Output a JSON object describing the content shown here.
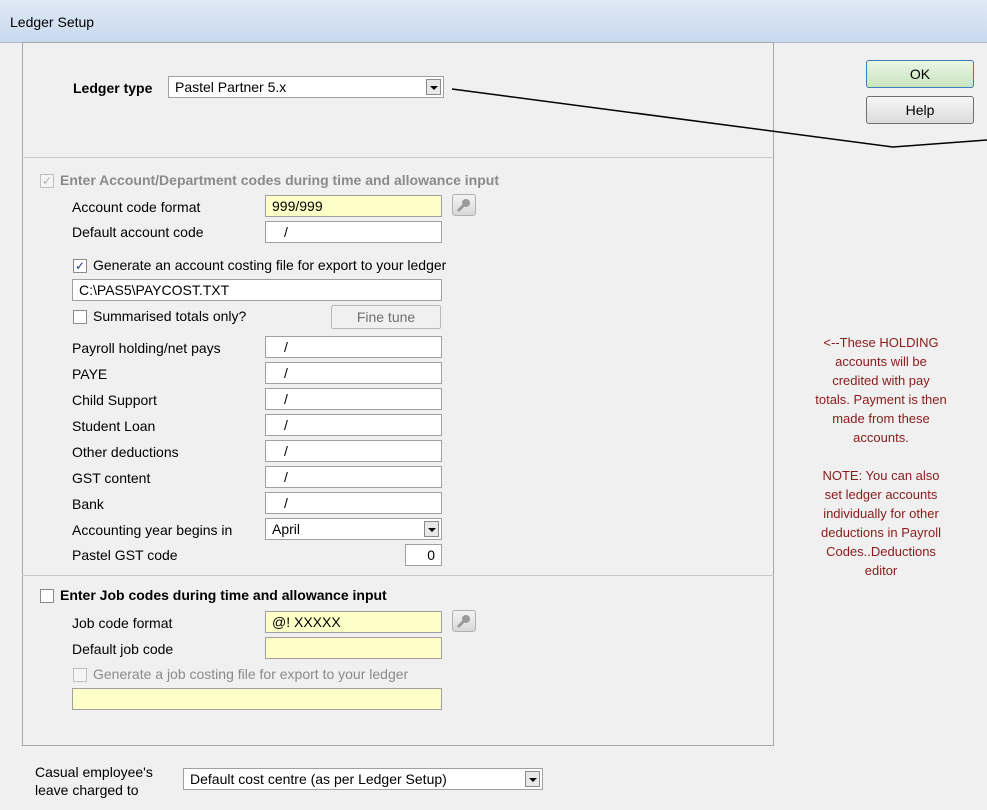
{
  "window": {
    "title": "Ledger Setup"
  },
  "buttons": {
    "ok": "OK",
    "help": "Help",
    "fine_tune": "Fine tune"
  },
  "ledger": {
    "label": "Ledger type",
    "value": "Pastel Partner 5.x"
  },
  "account_codes": {
    "enable_label": "Enter Account/Department codes during time and allowance input",
    "enable_checked": true,
    "format_label": "Account code format",
    "format_value": "999/999",
    "default_label": "Default account code",
    "default_value": "/",
    "generate_label": "Generate an account costing file for export to your ledger",
    "generate_checked": true,
    "file_path": "C:\\PAS5\\PAYCOST.TXT",
    "summarised_label": "Summarised totals only?",
    "summarised_checked": false
  },
  "holding_accounts": [
    {
      "label": "Payroll holding/net pays",
      "value": "/"
    },
    {
      "label": "PAYE",
      "value": "/"
    },
    {
      "label": "Child Support",
      "value": "/"
    },
    {
      "label": "Student Loan",
      "value": "/"
    },
    {
      "label": "Other deductions",
      "value": "/"
    },
    {
      "label": "GST content",
      "value": "/"
    },
    {
      "label": "Bank",
      "value": "/"
    }
  ],
  "accounting_year": {
    "label": "Accounting year begins in",
    "value": "April"
  },
  "gst_code": {
    "label": "Pastel GST code",
    "value": "0"
  },
  "job_codes": {
    "enable_label": "Enter Job codes during time and allowance input",
    "enable_checked": false,
    "format_label": "Job code format",
    "format_value": "@! XXXXX",
    "default_label": "Default job code",
    "default_value": "",
    "generate_label": "Generate a job costing file for export to your ledger",
    "generate_checked": false,
    "file_path": ""
  },
  "casual_leave": {
    "label_line1": "Casual employee's",
    "label_line2": "leave charged to",
    "value": "Default cost centre (as per Ledger Setup)"
  },
  "notes": {
    "line1": "<--These HOLDING",
    "line2": "accounts will be",
    "line3": "credited with pay",
    "line4": "totals. Payment is then",
    "line5": "made from these",
    "line6": "accounts.",
    "line7": "NOTE: You can also",
    "line8": "set ledger accounts",
    "line9": "individually for other",
    "line10": "deductions in Payroll",
    "line11": "Codes..Deductions",
    "line12": "editor"
  },
  "colors": {
    "note_text": "#8b1a1a",
    "highlight_field": "#ffffc8"
  }
}
